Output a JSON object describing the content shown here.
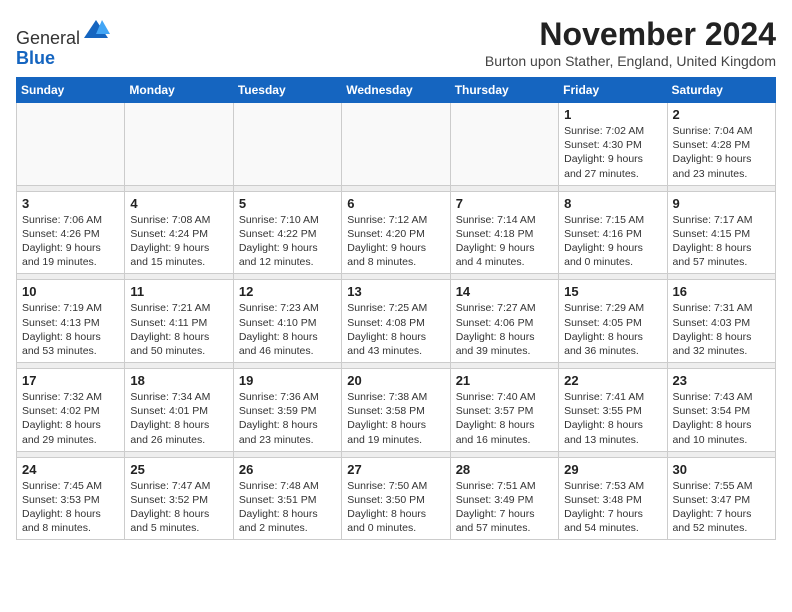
{
  "logo": {
    "line1": "General",
    "line2": "Blue"
  },
  "title": "November 2024",
  "location": "Burton upon Stather, England, United Kingdom",
  "days_of_week": [
    "Sunday",
    "Monday",
    "Tuesday",
    "Wednesday",
    "Thursday",
    "Friday",
    "Saturday"
  ],
  "weeks": [
    [
      {
        "day": "",
        "info": ""
      },
      {
        "day": "",
        "info": ""
      },
      {
        "day": "",
        "info": ""
      },
      {
        "day": "",
        "info": ""
      },
      {
        "day": "",
        "info": ""
      },
      {
        "day": "1",
        "info": "Sunrise: 7:02 AM\nSunset: 4:30 PM\nDaylight: 9 hours and 27 minutes."
      },
      {
        "day": "2",
        "info": "Sunrise: 7:04 AM\nSunset: 4:28 PM\nDaylight: 9 hours and 23 minutes."
      }
    ],
    [
      {
        "day": "3",
        "info": "Sunrise: 7:06 AM\nSunset: 4:26 PM\nDaylight: 9 hours and 19 minutes."
      },
      {
        "day": "4",
        "info": "Sunrise: 7:08 AM\nSunset: 4:24 PM\nDaylight: 9 hours and 15 minutes."
      },
      {
        "day": "5",
        "info": "Sunrise: 7:10 AM\nSunset: 4:22 PM\nDaylight: 9 hours and 12 minutes."
      },
      {
        "day": "6",
        "info": "Sunrise: 7:12 AM\nSunset: 4:20 PM\nDaylight: 9 hours and 8 minutes."
      },
      {
        "day": "7",
        "info": "Sunrise: 7:14 AM\nSunset: 4:18 PM\nDaylight: 9 hours and 4 minutes."
      },
      {
        "day": "8",
        "info": "Sunrise: 7:15 AM\nSunset: 4:16 PM\nDaylight: 9 hours and 0 minutes."
      },
      {
        "day": "9",
        "info": "Sunrise: 7:17 AM\nSunset: 4:15 PM\nDaylight: 8 hours and 57 minutes."
      }
    ],
    [
      {
        "day": "10",
        "info": "Sunrise: 7:19 AM\nSunset: 4:13 PM\nDaylight: 8 hours and 53 minutes."
      },
      {
        "day": "11",
        "info": "Sunrise: 7:21 AM\nSunset: 4:11 PM\nDaylight: 8 hours and 50 minutes."
      },
      {
        "day": "12",
        "info": "Sunrise: 7:23 AM\nSunset: 4:10 PM\nDaylight: 8 hours and 46 minutes."
      },
      {
        "day": "13",
        "info": "Sunrise: 7:25 AM\nSunset: 4:08 PM\nDaylight: 8 hours and 43 minutes."
      },
      {
        "day": "14",
        "info": "Sunrise: 7:27 AM\nSunset: 4:06 PM\nDaylight: 8 hours and 39 minutes."
      },
      {
        "day": "15",
        "info": "Sunrise: 7:29 AM\nSunset: 4:05 PM\nDaylight: 8 hours and 36 minutes."
      },
      {
        "day": "16",
        "info": "Sunrise: 7:31 AM\nSunset: 4:03 PM\nDaylight: 8 hours and 32 minutes."
      }
    ],
    [
      {
        "day": "17",
        "info": "Sunrise: 7:32 AM\nSunset: 4:02 PM\nDaylight: 8 hours and 29 minutes."
      },
      {
        "day": "18",
        "info": "Sunrise: 7:34 AM\nSunset: 4:01 PM\nDaylight: 8 hours and 26 minutes."
      },
      {
        "day": "19",
        "info": "Sunrise: 7:36 AM\nSunset: 3:59 PM\nDaylight: 8 hours and 23 minutes."
      },
      {
        "day": "20",
        "info": "Sunrise: 7:38 AM\nSunset: 3:58 PM\nDaylight: 8 hours and 19 minutes."
      },
      {
        "day": "21",
        "info": "Sunrise: 7:40 AM\nSunset: 3:57 PM\nDaylight: 8 hours and 16 minutes."
      },
      {
        "day": "22",
        "info": "Sunrise: 7:41 AM\nSunset: 3:55 PM\nDaylight: 8 hours and 13 minutes."
      },
      {
        "day": "23",
        "info": "Sunrise: 7:43 AM\nSunset: 3:54 PM\nDaylight: 8 hours and 10 minutes."
      }
    ],
    [
      {
        "day": "24",
        "info": "Sunrise: 7:45 AM\nSunset: 3:53 PM\nDaylight: 8 hours and 8 minutes."
      },
      {
        "day": "25",
        "info": "Sunrise: 7:47 AM\nSunset: 3:52 PM\nDaylight: 8 hours and 5 minutes."
      },
      {
        "day": "26",
        "info": "Sunrise: 7:48 AM\nSunset: 3:51 PM\nDaylight: 8 hours and 2 minutes."
      },
      {
        "day": "27",
        "info": "Sunrise: 7:50 AM\nSunset: 3:50 PM\nDaylight: 8 hours and 0 minutes."
      },
      {
        "day": "28",
        "info": "Sunrise: 7:51 AM\nSunset: 3:49 PM\nDaylight: 7 hours and 57 minutes."
      },
      {
        "day": "29",
        "info": "Sunrise: 7:53 AM\nSunset: 3:48 PM\nDaylight: 7 hours and 54 minutes."
      },
      {
        "day": "30",
        "info": "Sunrise: 7:55 AM\nSunset: 3:47 PM\nDaylight: 7 hours and 52 minutes."
      }
    ]
  ]
}
